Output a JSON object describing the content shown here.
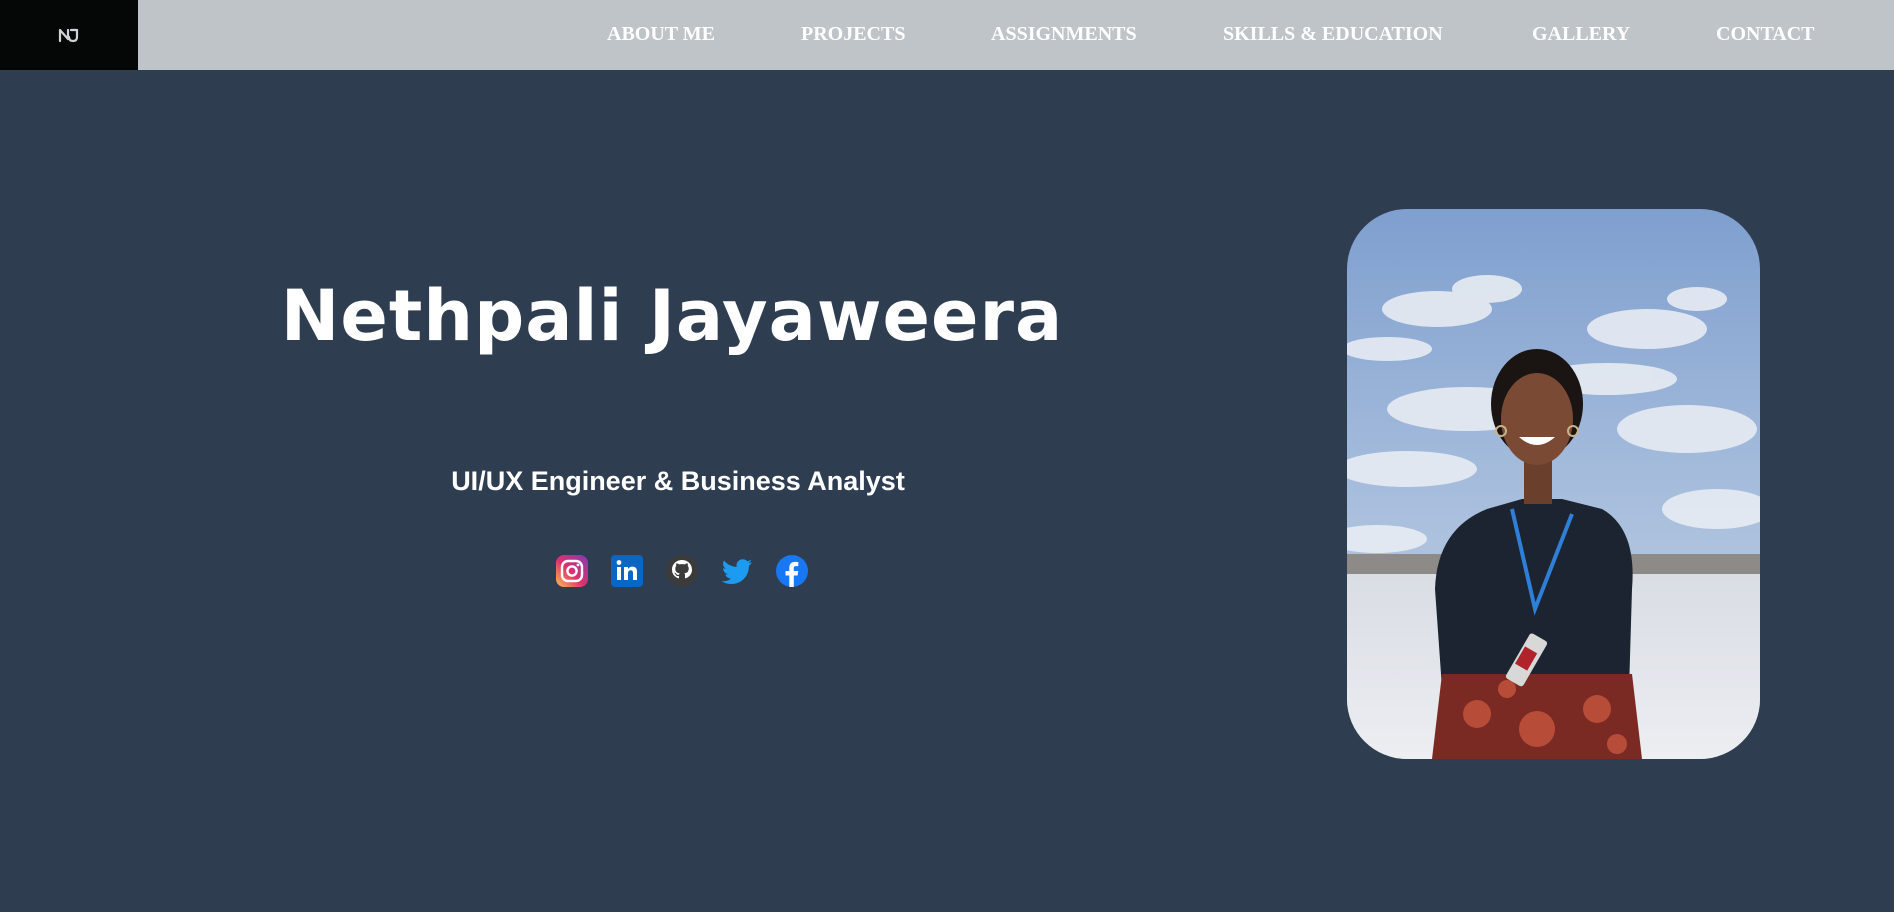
{
  "nav": {
    "logo_icon": "nj-monogram-icon",
    "items": [
      {
        "label": "ABOUT ME"
      },
      {
        "label": "PROJECTS"
      },
      {
        "label": "ASSIGNMENTS"
      },
      {
        "label": "SKILLS & EDUCATION"
      },
      {
        "label": "GALLERY"
      },
      {
        "label": "CONTACT"
      }
    ]
  },
  "hero": {
    "name": "Nethpali Jayaweera",
    "subtitle": "UI/UX Engineer & Business Analyst",
    "social_icons": [
      "instagram-icon",
      "linkedin-icon",
      "github-icon",
      "twitter-icon",
      "facebook-icon"
    ],
    "photo": "profile-photo"
  },
  "colors": {
    "background": "#2e3d50",
    "navbar": "#bfc4c9",
    "logo_box": "#050707",
    "text": "#ffffff"
  }
}
